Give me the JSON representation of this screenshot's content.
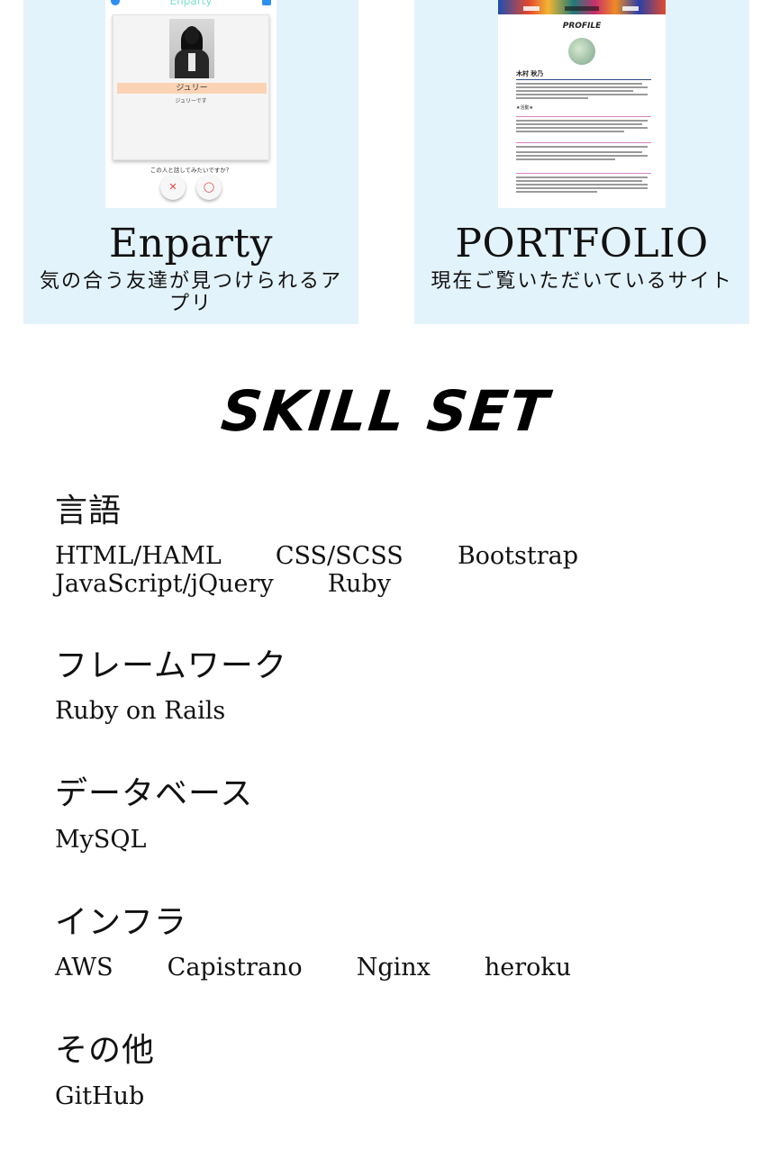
{
  "works": [
    {
      "title": "Enparty",
      "description": "気の合う友達が見つけられるアプリ",
      "mockup": {
        "app_name": "Enparty",
        "user_name": "ジュリー",
        "user_sub": "ジュリーです",
        "question": "この人と話してみたいですか？",
        "no_glyph": "✕",
        "yes_glyph": "◯"
      }
    },
    {
      "title": "PORTFOLIO",
      "description": "現在ご覧いただいているサイト",
      "mockup": {
        "heading": "PROFILE",
        "name": "木村 秋乃",
        "section_1": "★活動★"
      }
    }
  ],
  "skill_set": {
    "title": "SKILL SET",
    "categories": [
      {
        "name": "言語",
        "items": [
          "HTML/HAML",
          "CSS/SCSS",
          "Bootstrap",
          "JavaScript/jQuery",
          "Ruby"
        ]
      },
      {
        "name": "フレームワーク",
        "items": [
          "Ruby on Rails"
        ]
      },
      {
        "name": "データベース",
        "items": [
          "MySQL"
        ]
      },
      {
        "name": "インフラ",
        "items": [
          "AWS",
          "Capistrano",
          "Nginx",
          "heroku"
        ]
      },
      {
        "name": "その他",
        "items": [
          "GitHub"
        ]
      }
    ]
  },
  "colors": {
    "card_bg": "#e3f3fb",
    "text": "#111111",
    "enparty_accent": "#2d8ff0",
    "enparty_namebar": "#fbd3b4",
    "enparty_button_mark": "#e0463e"
  }
}
